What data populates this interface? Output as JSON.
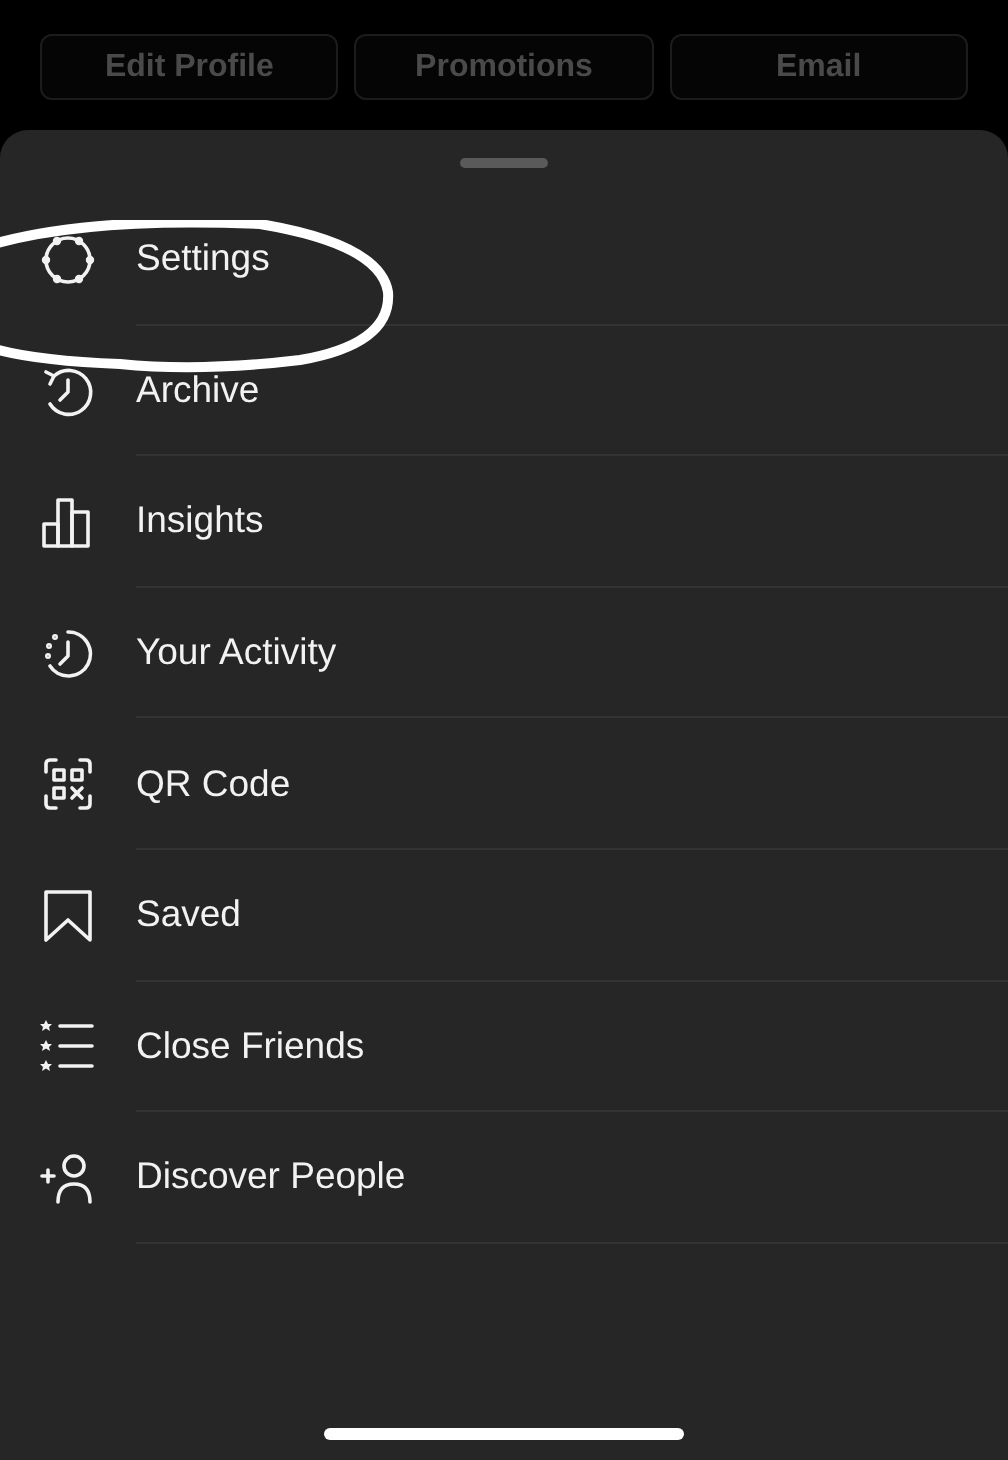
{
  "profile_buttons": [
    {
      "label": "Edit Profile"
    },
    {
      "label": "Promotions"
    },
    {
      "label": "Email"
    }
  ],
  "menu": [
    {
      "label": "Settings",
      "kind": "settings"
    },
    {
      "label": "Archive",
      "kind": "archive"
    },
    {
      "label": "Insights",
      "kind": "insights"
    },
    {
      "label": "Your Activity",
      "kind": "activity"
    },
    {
      "label": "QR Code",
      "kind": "qr"
    },
    {
      "label": "Saved",
      "kind": "saved"
    },
    {
      "label": "Close Friends",
      "kind": "friends"
    },
    {
      "label": "Discover People",
      "kind": "discover"
    }
  ]
}
